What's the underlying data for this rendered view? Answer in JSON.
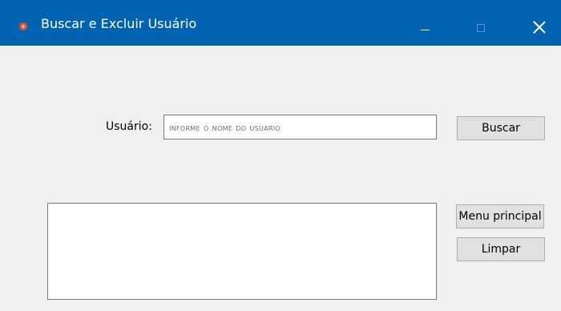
{
  "window": {
    "title": "Buscar e Excluir Usuário",
    "accent_color": "#0063b1",
    "icon": "app-icon",
    "controls": [
      "minimize-icon",
      "maximize-icon",
      "close-icon"
    ]
  },
  "form": {
    "user_label": "Usuário:",
    "user_input_placeholder": "Informe o nome do usuario",
    "user_input_value": "",
    "search_button_label": "Buscar",
    "menu_button_label": "Menu principal",
    "clear_button_label": "Limpar"
  },
  "results": {
    "items": []
  }
}
